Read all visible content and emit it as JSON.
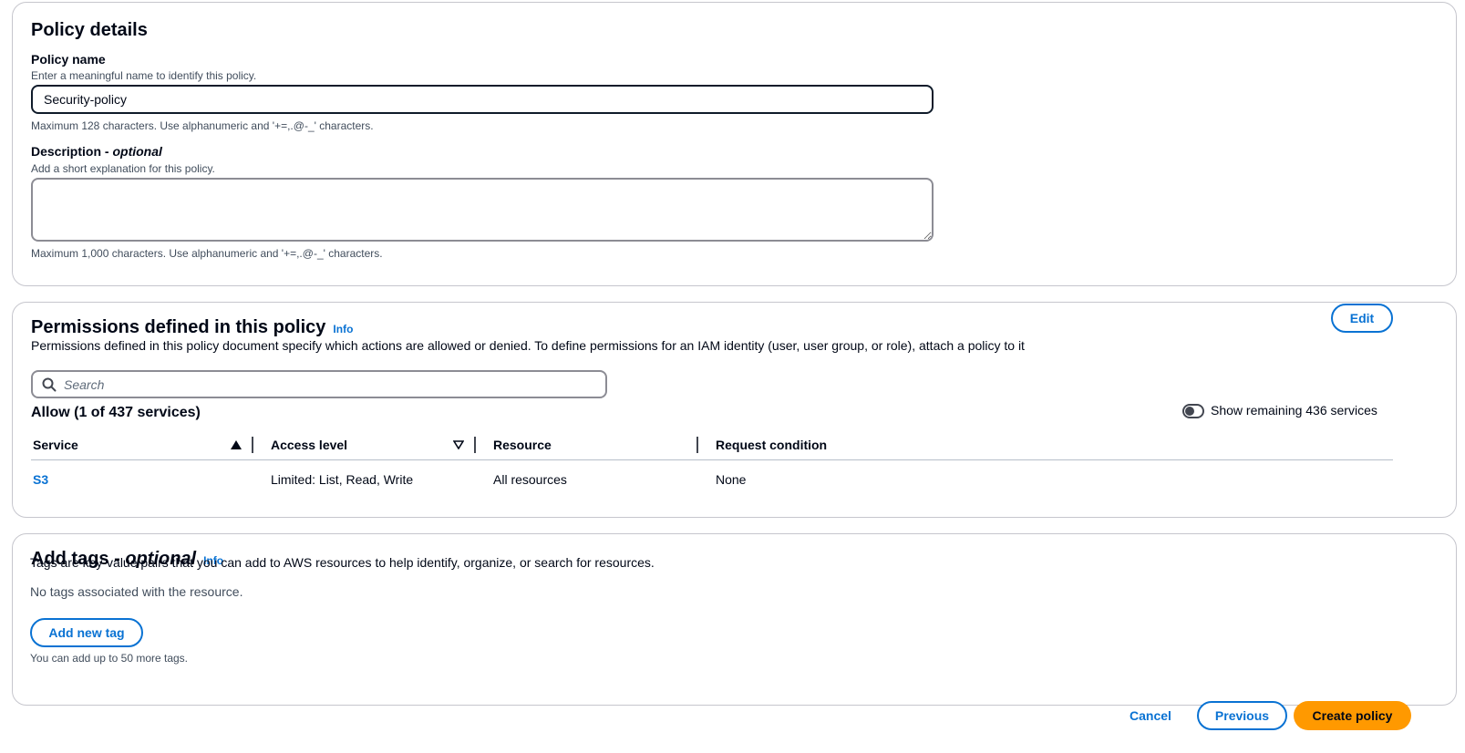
{
  "policy_details": {
    "title": "Policy details",
    "name_label": "Policy name",
    "name_hint": "Enter a meaningful name to identify this policy.",
    "name_value": "Security-policy",
    "name_constraint": "Maximum 128 characters. Use alphanumeric and '+=,.@-_' characters.",
    "description_label": "Description -",
    "description_optional": "optional",
    "description_hint": "Add a short explanation for this policy.",
    "description_value": "",
    "description_constraint": "Maximum 1,000 characters. Use alphanumeric and '+=,.@-_' characters."
  },
  "permissions": {
    "title": "Permissions defined in this policy",
    "info": "Info",
    "edit_label": "Edit",
    "description": "Permissions defined in this policy document specify which actions are allowed or denied. To define permissions for an IAM identity (user, user group, or role), attach a policy to it",
    "search_placeholder": "Search",
    "allow_heading": "Allow (1 of 437 services)",
    "toggle_label": "Show remaining 436 services",
    "toggle_on": false,
    "columns": [
      "Service",
      "Access level",
      "Resource",
      "Request condition"
    ],
    "rows": [
      {
        "service": "S3",
        "access_level": "Limited: List, Read, Write",
        "resource": "All resources",
        "request_condition": "None"
      }
    ]
  },
  "tags": {
    "title": "Add tags -",
    "title_optional": "optional",
    "info": "Info",
    "description": "Tags are key-value pairs that you can add to AWS resources to help identify, organize, or search for resources.",
    "empty_text": "No tags associated with the resource.",
    "add_button": "Add new tag",
    "limit_text": "You can add up to 50 more tags."
  },
  "footer": {
    "cancel": "Cancel",
    "previous": "Previous",
    "create": "Create policy"
  },
  "colors": {
    "link": "#0972d3",
    "primary": "#ff9900",
    "border": "#c6c6cd",
    "text": "#000716"
  }
}
